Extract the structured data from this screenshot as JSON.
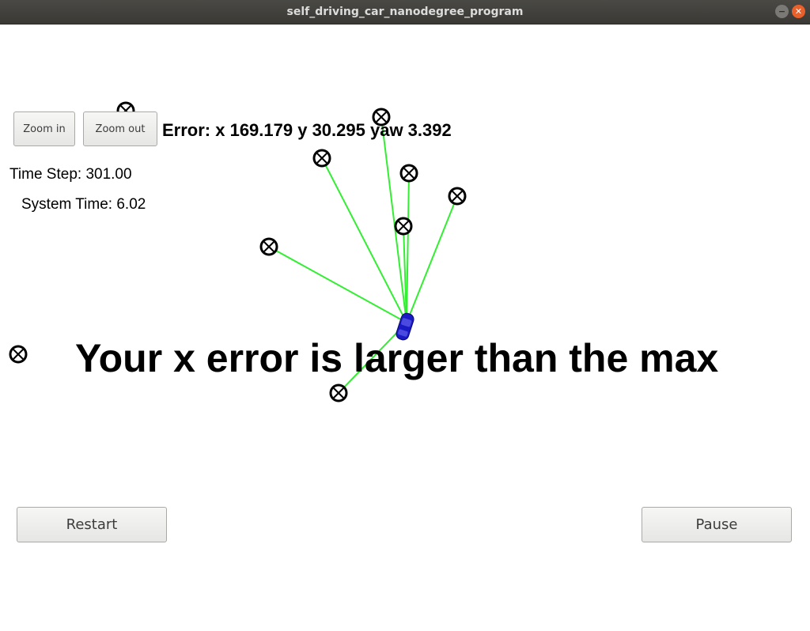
{
  "window": {
    "title": "self_driving_car_nanodegree_program",
    "minimize_glyph": "−",
    "close_glyph": "✕"
  },
  "toolbar": {
    "zoom_in_label": "Zoom in",
    "zoom_out_label": "Zoom out"
  },
  "status": {
    "error_text": "Error: x 169.179 y 30.295 yaw 3.392",
    "time_step_text": "Time Step: 301.00",
    "system_time_text": "System Time: 6.02"
  },
  "alert": {
    "message": "Your x error is larger than the max"
  },
  "controls": {
    "restart_label": "Restart",
    "pause_label": "Pause"
  },
  "colors": {
    "observation_line": "#33ee33",
    "vehicle": "#1515bb",
    "landmark": "#000000"
  },
  "icons": {
    "landmark": "landmark-icon",
    "vehicle": "vehicle-icon"
  }
}
